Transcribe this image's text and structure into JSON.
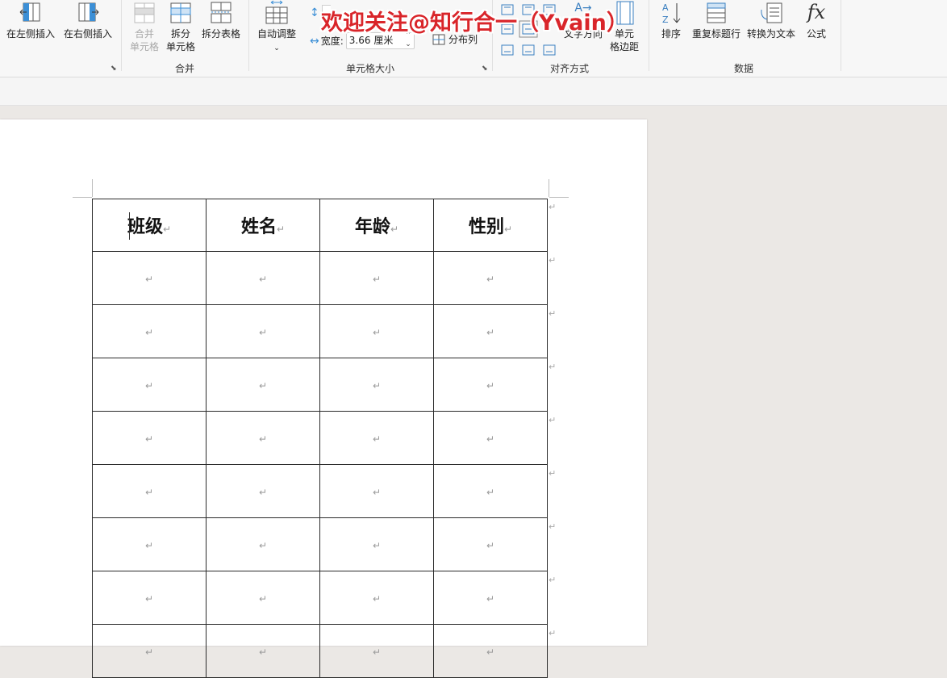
{
  "ribbon": {
    "insert_group": {
      "left_label": "在左侧插入",
      "right_label": "在右侧插入"
    },
    "merge_group": {
      "title": "合并",
      "merge_cells_line1": "合并",
      "merge_cells_line2": "单元格",
      "split_cells_line1": "拆分",
      "split_cells_line2": "单元格",
      "split_table": "拆分表格"
    },
    "cell_size_group": {
      "title": "单元格大小",
      "autofit": "自动调整",
      "width_label": "宽度:",
      "width_value": "3.66 厘米",
      "distribute_columns": "分布列"
    },
    "alignment_group": {
      "title": "对齐方式",
      "text_direction": "文字方向",
      "cell_margins_line1": "单元",
      "cell_margins_line2": "格边距"
    },
    "data_group": {
      "title": "数据",
      "sort": "排序",
      "repeat_header": "重复标题行",
      "convert_to_text": "转换为文本",
      "formula": "公式"
    }
  },
  "watermark": "欢迎关注@知行合一（Yvain）",
  "document": {
    "headers": [
      "班级",
      "姓名",
      "年龄",
      "性别"
    ],
    "paragraph_mark": "↵",
    "empty_rows": 8
  }
}
